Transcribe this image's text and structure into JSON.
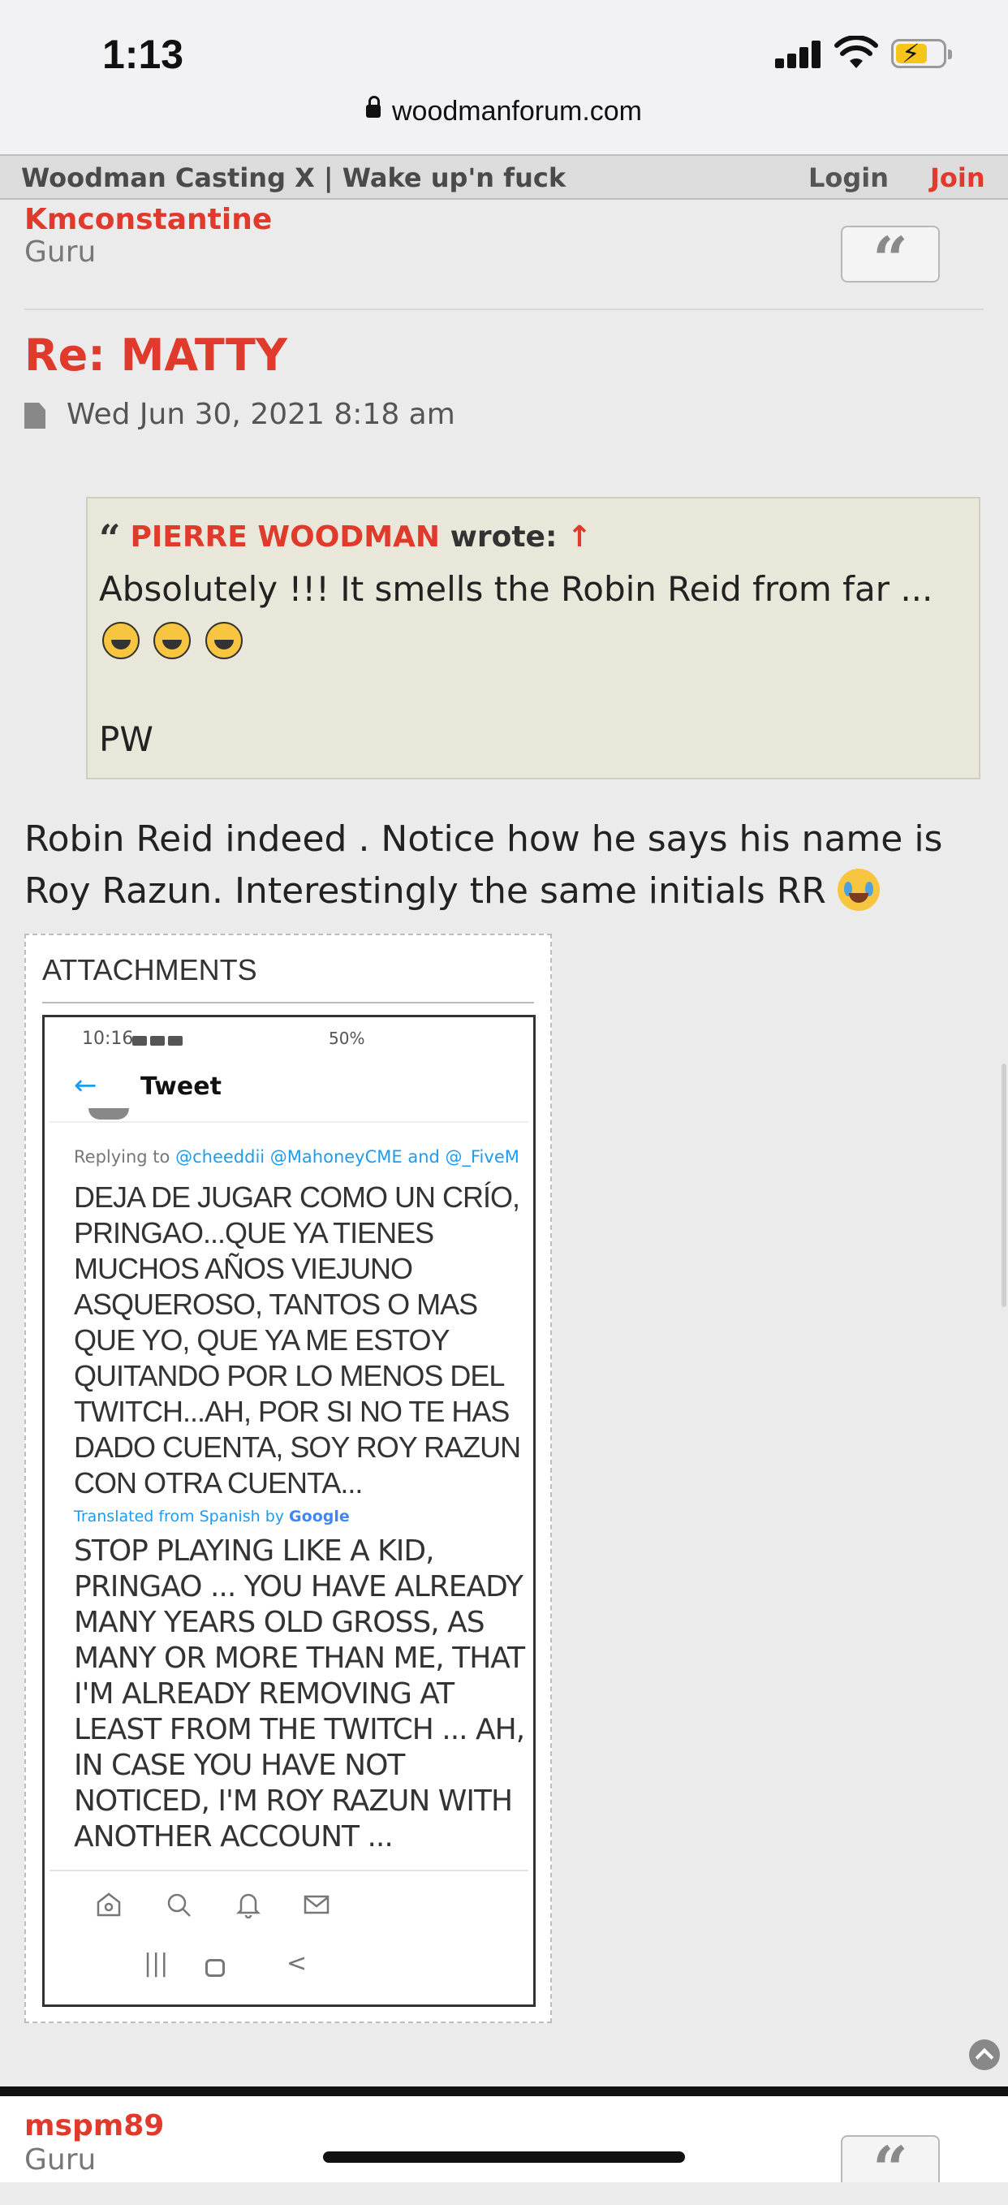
{
  "status_bar": {
    "time": "1:13"
  },
  "browser": {
    "url": "woodmanforum.com"
  },
  "forum_header": {
    "title": "Woodman Casting X | Wake up'n fuck",
    "login": "Login",
    "join": "Join"
  },
  "prev_post": {
    "username": "Kmconstantine",
    "rank": "Guru",
    "quote_icon": "quote-icon"
  },
  "post": {
    "title": "Re: MATTY",
    "date": "Wed Jun 30, 2021 8:18 am",
    "quote": {
      "author": "PIERRE WOODMAN",
      "wrote": "wrote:",
      "arrow": "↑",
      "text": "Absolutely !!! It smells the Robin Reid from far ...",
      "signature": "PW"
    },
    "body": "Robin Reid indeed . Notice how he says his name is Roy Razun. Interestingly the same initials RR",
    "attachments": {
      "label": "ATTACHMENTS",
      "screenshot": {
        "phone_time": "10:16",
        "phone_status": "50%",
        "header": "Tweet",
        "back": "←",
        "replying_prefix": "Replying to",
        "replying_to": "@cheeddii @MahoneyCME and @_FiveM",
        "spanish_text": "DEJA DE JUGAR COMO UN CRÍO, PRINGAO...QUE YA TIENES MUCHOS AÑOS VIEJUNO ASQUEROSO, TANTOS O MAS QUE YO, QUE YA ME ESTOY QUITANDO POR LO MENOS DEL TWITCH...AH, POR SI NO TE HAS DADO CUENTA, SOY ROY RAZUN CON OTRA CUENTA...",
        "translated_label": "Translated from Spanish by",
        "translator": "Google",
        "english_text": "STOP PLAYING LIKE A KID, PRINGAO ... YOU HAVE ALREADY MANY YEARS OLD GROSS, AS MANY OR MORE THAN ME, THAT I'M ALREADY REMOVING AT LEAST FROM THE TWITCH ... AH, IN CASE YOU HAVE NOT NOTICED, I'M ROY RAZUN WITH ANOTHER ACCOUNT ...",
        "nav_recent": "|||",
        "nav_back": "<"
      }
    }
  },
  "next_post": {
    "username": "mspm89",
    "rank": "Guru"
  },
  "colors": {
    "accent": "#e03a2c",
    "quote_bg": "#e8e7d9",
    "page_bg": "#ebebeb"
  }
}
